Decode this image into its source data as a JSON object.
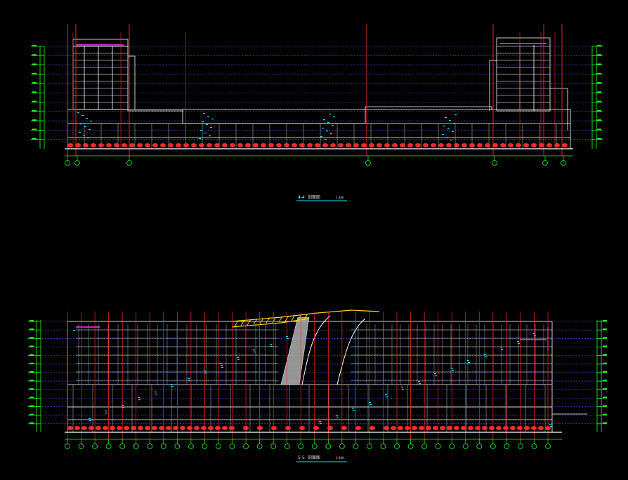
{
  "drawing": {
    "section_a": {
      "label": "4-4",
      "caption": "剖面图",
      "scale": "1:300",
      "floors": 11,
      "grid_axes": 8
    },
    "section_b": {
      "label": "5-5",
      "caption": "剖面图",
      "scale": "1:300",
      "floors": 13,
      "grid_axes": 36
    }
  },
  "colors": {
    "background": "#000000",
    "level_line": "#5a5aff",
    "structure": "#ffffff",
    "column": "#ff2a2a",
    "dimension": "#22ff22",
    "accent": "#ff33ff",
    "truss": "#ffd21a",
    "annotation": "#00e5ff",
    "ramp": "#b0b0b0"
  }
}
